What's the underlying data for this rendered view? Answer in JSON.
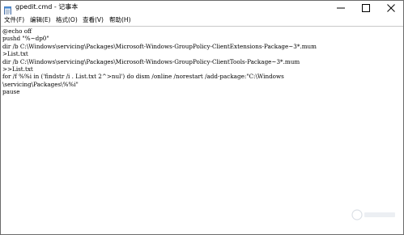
{
  "window": {
    "title": "gpedit.cmd - 记事本",
    "icon": "notepad-icon"
  },
  "window_controls": {
    "minimize_icon": "minimize-icon",
    "maximize_icon": "maximize-icon",
    "close_icon": "close-icon"
  },
  "menu": {
    "items": [
      {
        "label": "文件(F)"
      },
      {
        "label": "编辑(E)"
      },
      {
        "label": "格式(O)"
      },
      {
        "label": "查看(V)"
      },
      {
        "label": "帮助(H)"
      }
    ]
  },
  "editor": {
    "lines": [
      "@echo off",
      "pushd \"%~dp0\"",
      "dir /b C:\\Windows\\servicing\\Packages\\Microsoft-Windows-GroupPolicy-ClientExtensions-Package~3*.mum",
      ">List.txt",
      "dir /b C:\\Windows\\servicing\\Packages\\Microsoft-Windows-GroupPolicy-ClientTools-Package~3*.mum",
      ">>List.txt",
      "for /f %%i in ('findstr /i . List.txt 2^>nul') do dism /online /norestart /add-package:\"C:\\Windows",
      "\\servicing\\Packages\\%%i\"",
      "pause"
    ]
  },
  "colors": {
    "window_border": "#6b6b6b",
    "text": "#000000",
    "background": "#ffffff"
  }
}
